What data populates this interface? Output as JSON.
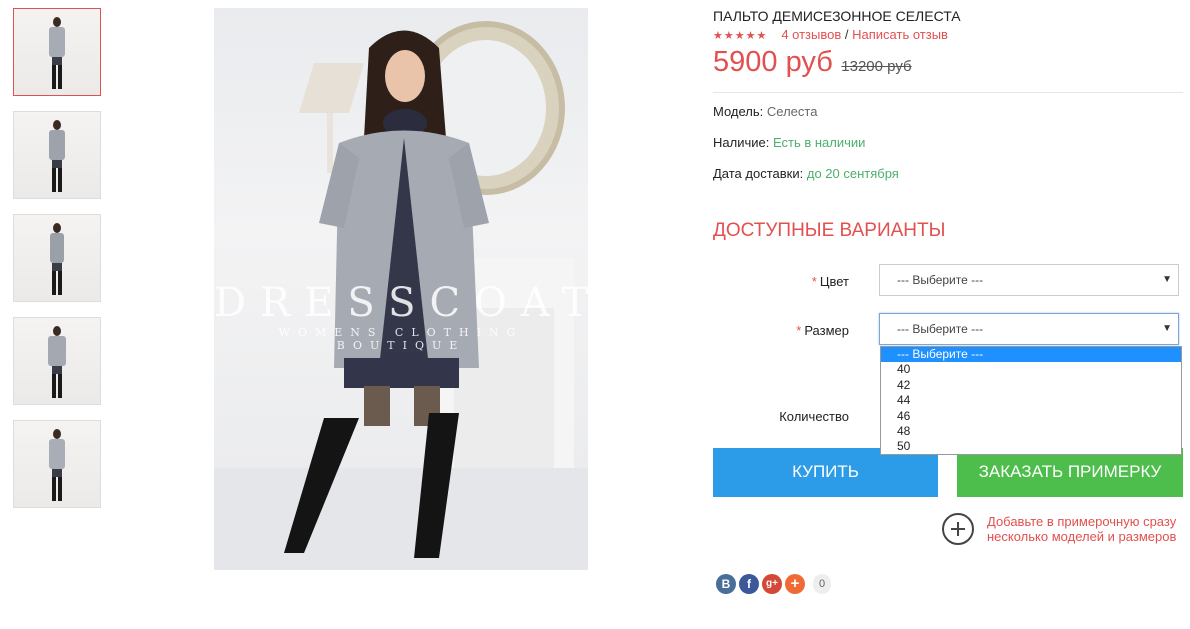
{
  "product": {
    "title": "ПАЛЬТО ДЕМИСЕЗОННОЕ СЕЛЕСТА",
    "stars": "★★★★★",
    "rating": 5,
    "reviews_link": "4 отзывов",
    "rating_separator": "/",
    "write_review_link": "Написать отзыв",
    "price_new": "5900 руб",
    "price_old": "13200 руб"
  },
  "details": {
    "model_label": "Модель:",
    "model_value": "Селеста",
    "stock_label": "Наличие:",
    "stock_value": "Есть в наличии",
    "delivery_label": "Дата доставки:",
    "delivery_value": "до 20 сентября"
  },
  "options": {
    "heading": "ДОСТУПНЫЕ ВАРИАНТЫ",
    "required_mark": "*",
    "color_label": "Цвет",
    "color_value": "--- Выберите ---",
    "size_label": "Размер",
    "size_value": "--- Выберите ---",
    "size_options": [
      "--- Выберите ---",
      "40",
      "42",
      "44",
      "46",
      "48",
      "50"
    ],
    "quantity_label": "Количество"
  },
  "actions": {
    "buy_label": "КУПИТЬ",
    "fitting_label": "ЗАКАЗАТЬ ПРИМЕРКУ",
    "fitting_note": "Добавьте в примерочную сразу несколько моделей и размеров"
  },
  "gallery": {
    "watermark_title": "DRESSCOAT",
    "watermark_sub": "WOMENS CLOTHING BOUTIQUE",
    "thumbnail_count": 5
  },
  "social": {
    "vk": "B",
    "facebook": "f",
    "gplus": "g+",
    "more": "+",
    "share_count": "0"
  },
  "colors": {
    "accent_red": "#e2504f",
    "buy_blue": "#2d9ce8",
    "fitting_green": "#4dbd4b",
    "in_stock_green": "#4caf6d"
  }
}
